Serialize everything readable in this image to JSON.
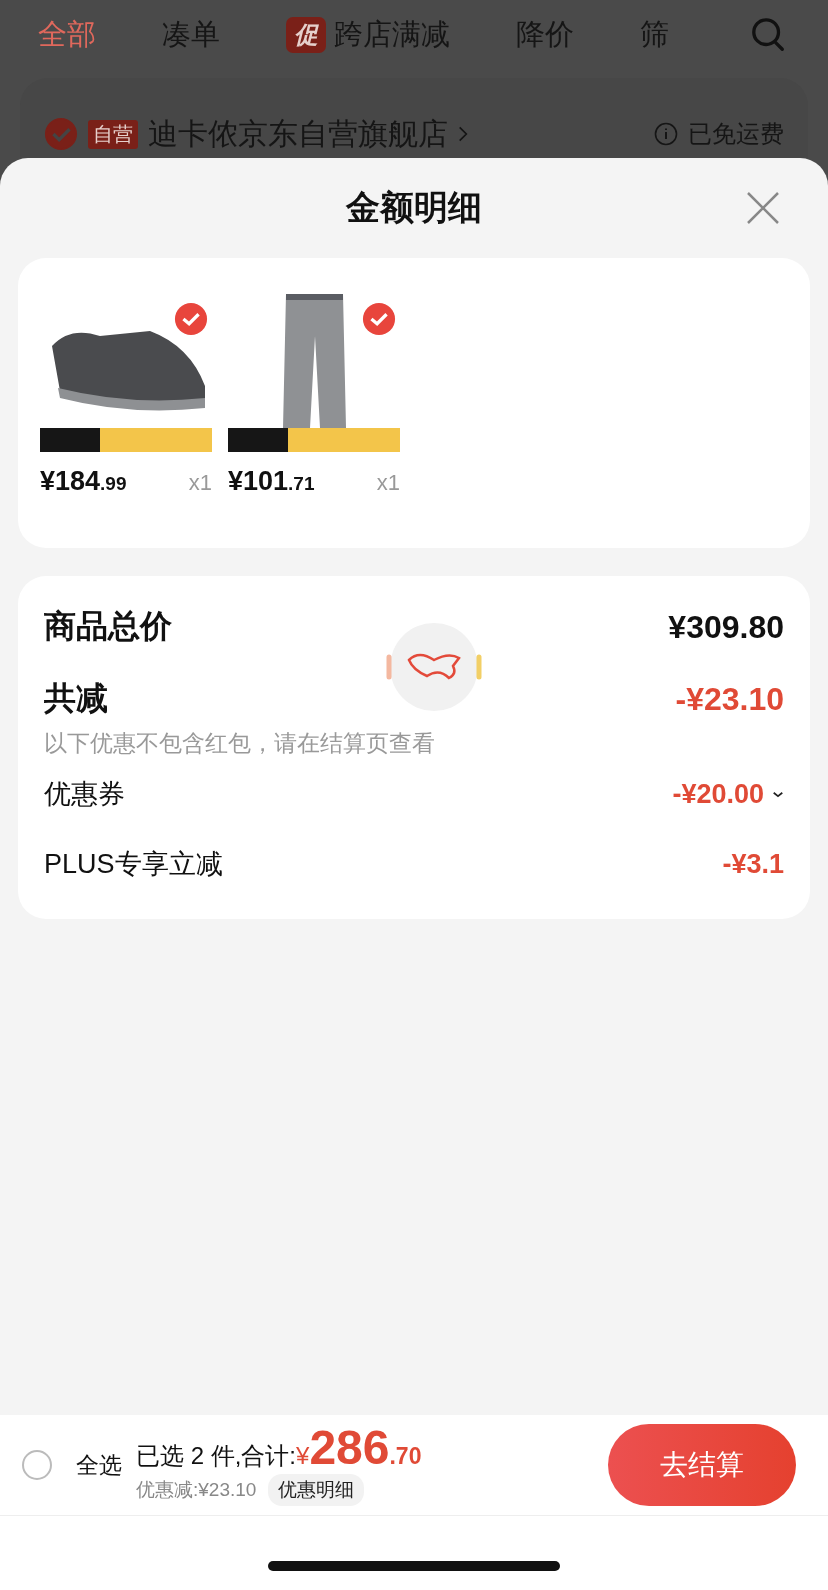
{
  "background": {
    "tabs": [
      {
        "label": "全部",
        "selected": true
      },
      {
        "label": "凑单",
        "selected": false
      },
      {
        "label": "跨店满减",
        "selected": false,
        "badge": "促"
      },
      {
        "label": "降价",
        "selected": false
      },
      {
        "label": "筛",
        "selected": false
      }
    ],
    "store": {
      "checked": true,
      "tag": "自营",
      "name": "迪卡侬京东自营旗舰店",
      "shipping": "已免运费"
    }
  },
  "sheet": {
    "title": "金额明细",
    "products": [
      {
        "kind": "shoe",
        "checked": true,
        "price": "¥184",
        "price_decimal": ".99",
        "quantity": "x1"
      },
      {
        "kind": "pants",
        "checked": true,
        "price": "¥101",
        "price_decimal": ".71",
        "quantity": "x1"
      }
    ],
    "total": {
      "label": "商品总价",
      "value": "¥309.80"
    },
    "reduction": {
      "label": "共减",
      "value": "-¥23.10",
      "note": "以下优惠不包含红包，请在结算页查看"
    },
    "discounts": [
      {
        "label": "优惠券",
        "value": "-¥20.00",
        "expandable": true
      },
      {
        "label": "PLUS专享立减",
        "value": "-¥3.1",
        "expandable": false
      }
    ]
  },
  "bottom_bar": {
    "select_all": {
      "label": "全选",
      "checked": false
    },
    "summary": "已选 2 件,合计:",
    "currency": "¥",
    "amount": "286",
    "amount_decimal": ".70",
    "discount_note": "优惠减:¥23.10",
    "detail_button": "优惠明细",
    "checkout": "去结算"
  }
}
